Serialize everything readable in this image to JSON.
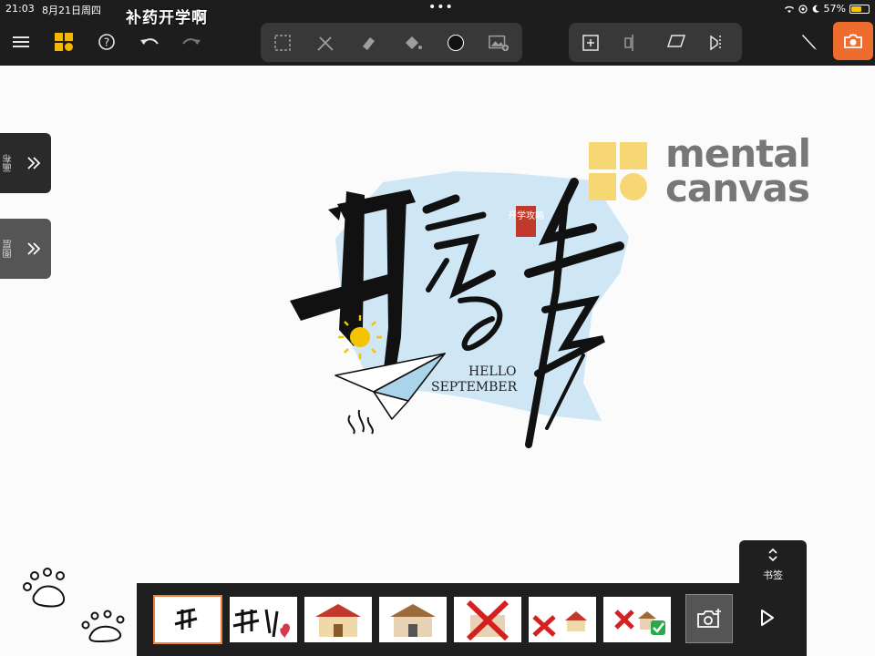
{
  "status_bar": {
    "time": "21:03",
    "date": "8月21日周四",
    "battery": "57%",
    "battery_level": 0.57,
    "dots": "•••"
  },
  "caption": "补药开学啊",
  "toolbar": {
    "left_icons": [
      "menu-icon",
      "palette-icon",
      "help-icon",
      "undo-icon",
      "redo-icon"
    ],
    "drawing_tools": [
      "select-icon",
      "pen-cross-icon",
      "eraser-icon",
      "fill-bucket-icon",
      "brush-size-icon",
      "image-add-icon"
    ],
    "canvas_tools": [
      "add-frame-icon",
      "split-icon",
      "plane-icon",
      "mirror-icon"
    ],
    "right_tools": [
      "pen-icon",
      "camera-icon"
    ]
  },
  "side_tabs": [
    {
      "label": "画布",
      "icon": "double-chevron-right-icon"
    },
    {
      "label": "图层",
      "icon": "double-chevron-right-icon"
    }
  ],
  "canvas": {
    "artwork": {
      "title_chars": "开学季",
      "seal": "开学攻略",
      "hello": "HELLO",
      "september": "SEPTEMBER"
    },
    "brand": {
      "line1": "mental",
      "line2": "canvas",
      "color": "#f7d774"
    }
  },
  "bookmark": {
    "label": "书签",
    "icon": "chevron-up-down-icon"
  },
  "filmstrip": {
    "frames": [
      {
        "label": "frame-1",
        "selected": true
      },
      {
        "label": "frame-2",
        "selected": false
      },
      {
        "label": "frame-3",
        "selected": false
      },
      {
        "label": "frame-4",
        "selected": false
      },
      {
        "label": "frame-5",
        "selected": false
      },
      {
        "label": "frame-6",
        "selected": false
      },
      {
        "label": "frame-7",
        "selected": false
      }
    ],
    "capture_icon": "camera-add-icon",
    "play_icon": "play-icon"
  },
  "colors": {
    "accent": "#ef6c2f",
    "toolbar_bg": "#1d1d1d",
    "logo_yellow": "#f7d774",
    "sky_blue": "#cfe6f5"
  }
}
